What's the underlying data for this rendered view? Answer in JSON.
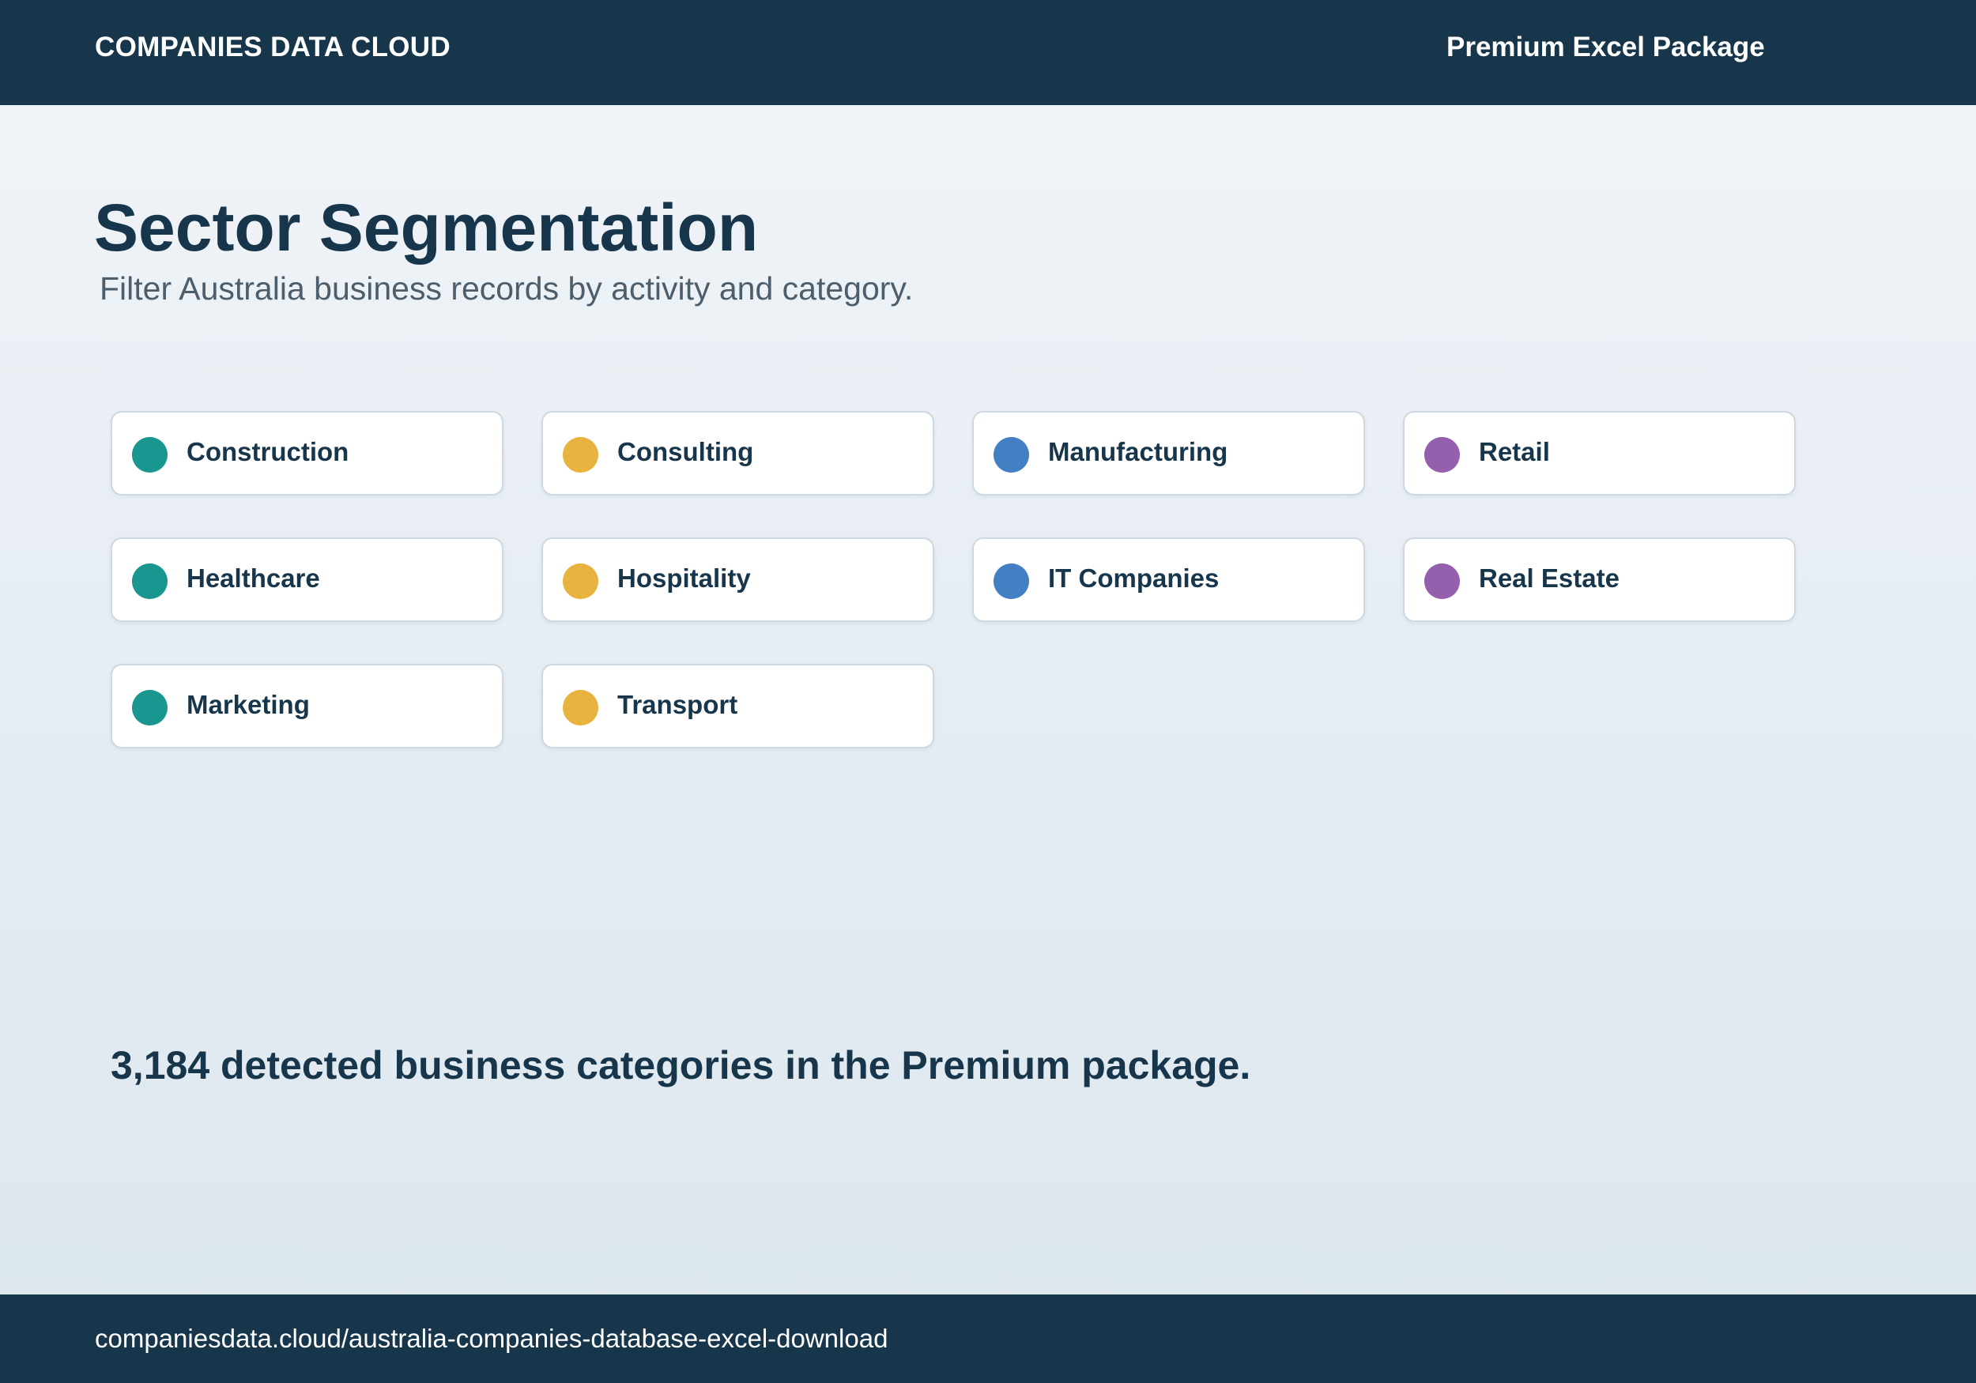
{
  "header": {
    "brand": "COMPANIES DATA CLOUD",
    "package": "Premium Excel Package"
  },
  "main": {
    "title": "Sector Segmentation",
    "subtitle": "Filter Australia business records by activity and category."
  },
  "sectors": [
    {
      "label": "Construction",
      "color": "#1a9690"
    },
    {
      "label": "Consulting",
      "color": "#e8b33e"
    },
    {
      "label": "Manufacturing",
      "color": "#427fc3"
    },
    {
      "label": "Retail",
      "color": "#9460ad"
    },
    {
      "label": "Healthcare",
      "color": "#1a9690"
    },
    {
      "label": "Hospitality",
      "color": "#e8b33e"
    },
    {
      "label": "IT Companies",
      "color": "#427fc3"
    },
    {
      "label": "Real Estate",
      "color": "#9460ad"
    },
    {
      "label": "Marketing",
      "color": "#1a9690"
    },
    {
      "label": "Transport",
      "color": "#e8b33e"
    }
  ],
  "summary": "3,184 detected business categories in the Premium package.",
  "footer": {
    "url": "companiesdata.cloud/australia-companies-database-excel-download"
  },
  "colors": {
    "navy": "#17364b",
    "teal": "#1a9690",
    "amber": "#e8b33e",
    "blue": "#427fc3",
    "purple": "#9460ad"
  }
}
